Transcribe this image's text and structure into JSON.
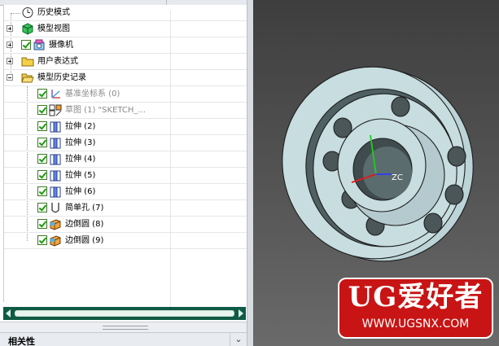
{
  "navigator": {
    "items": [
      {
        "label": "历史模式",
        "level": 0,
        "expander": "none",
        "icon": "clock-icon"
      },
      {
        "label": "模型视图",
        "level": 0,
        "expander": "plus",
        "icon": "model-view-icon"
      },
      {
        "label": "摄像机",
        "level": 0,
        "expander": "plus",
        "icon": "camera-icon",
        "checked": true
      },
      {
        "label": "用户表达式",
        "level": 0,
        "expander": "plus",
        "icon": "folder-icon"
      },
      {
        "label": "模型历史记录",
        "level": 0,
        "expander": "minus",
        "icon": "folder-open-icon"
      },
      {
        "label": "基准坐标系 (0)",
        "level": 1,
        "icon": "datum-csys-icon",
        "checked": true,
        "dim": true
      },
      {
        "label": "草图 (1) \"SKETCH_...",
        "level": 1,
        "icon": "sketch-icon",
        "checked": true,
        "dim": true
      },
      {
        "label": "拉伸 (2)",
        "level": 1,
        "icon": "extrude-icon",
        "checked": true
      },
      {
        "label": "拉伸 (3)",
        "level": 1,
        "icon": "extrude-icon",
        "checked": true
      },
      {
        "label": "拉伸 (4)",
        "level": 1,
        "icon": "extrude-icon",
        "checked": true
      },
      {
        "label": "拉伸 (5)",
        "level": 1,
        "icon": "extrude-icon",
        "checked": true
      },
      {
        "label": "拉伸 (6)",
        "level": 1,
        "icon": "extrude-icon",
        "checked": true
      },
      {
        "label": "简单孔 (7)",
        "level": 1,
        "icon": "hole-icon",
        "checked": true
      },
      {
        "label": "边倒圆 (8)",
        "level": 1,
        "icon": "edge-blend-icon",
        "checked": true
      },
      {
        "label": "边倒圆 (9)",
        "level": 1,
        "icon": "edge-blend-icon",
        "checked": true
      }
    ]
  },
  "dependencies": {
    "title": "相关性"
  },
  "viewport": {
    "axis_label": "ZC",
    "colors": {
      "part": "#c7dde0",
      "part_edge": "#2a2a2a",
      "background": "#4a4a4a"
    }
  },
  "watermark": {
    "title": "UG爱好者",
    "url": "WWW.UGSNX.COM"
  }
}
